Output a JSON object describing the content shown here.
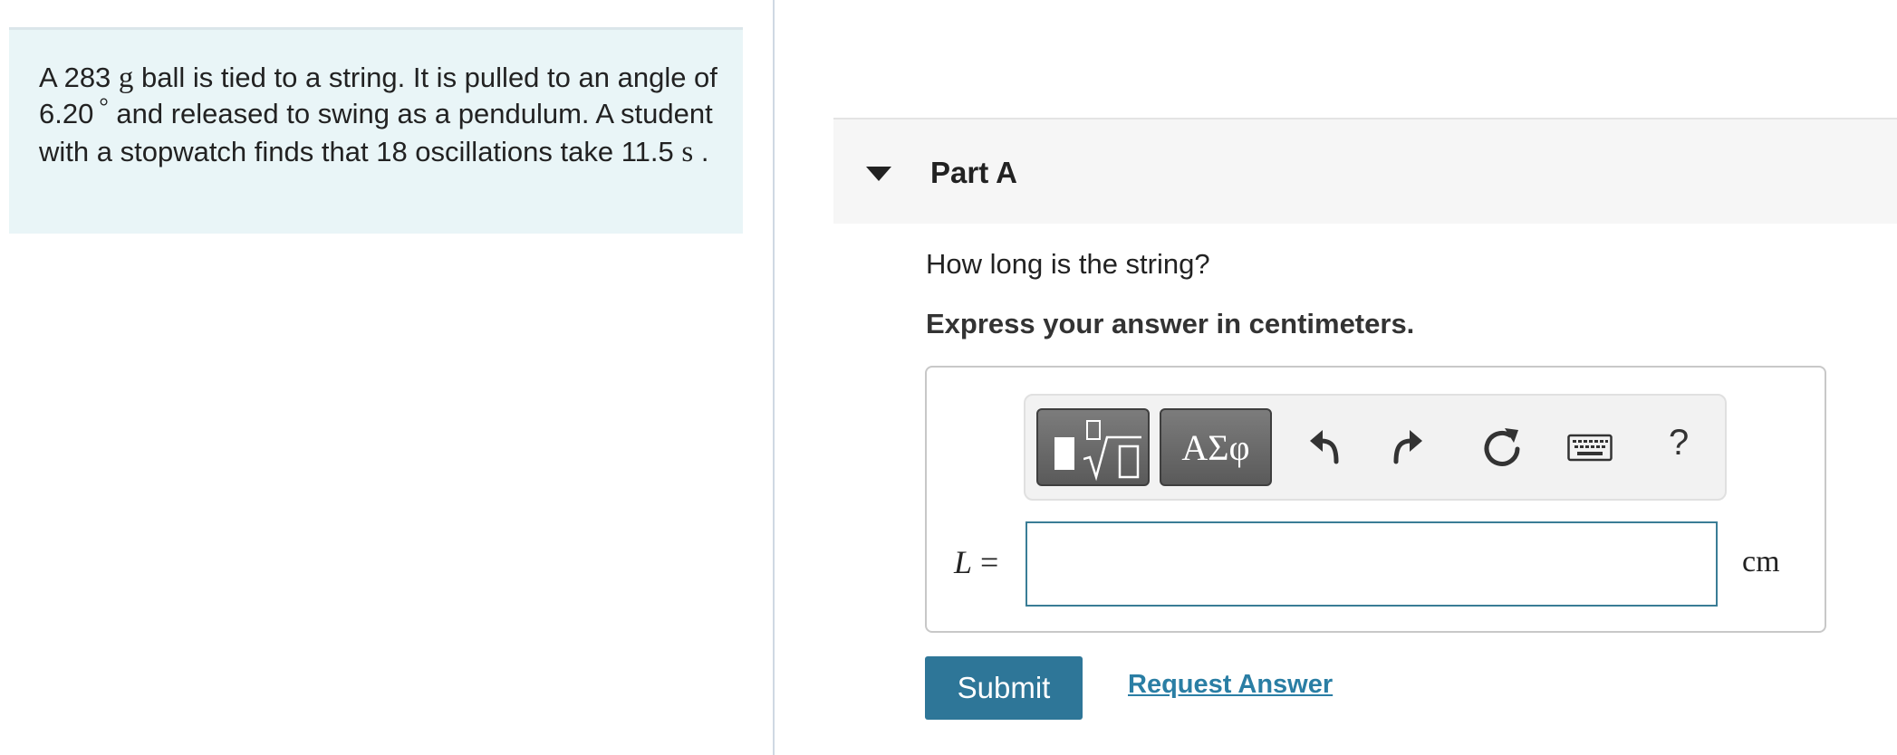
{
  "problem": {
    "segments": [
      "A 283 ",
      "g",
      " ball is tied to a string. It is pulled to an angle of 6.20",
      "°",
      " and released to swing as a pendulum. A student with a stopwatch finds that 18 oscillations take 11.5 ",
      "s",
      " ."
    ]
  },
  "part": {
    "title": "Part A",
    "question": "How long is the string?",
    "instruction": "Express your answer in centimeters."
  },
  "toolbar": {
    "greek_label": "ΑΣφ",
    "help_label": "?"
  },
  "answer": {
    "variable": "L",
    "equals": "=",
    "value": "",
    "unit": "cm"
  },
  "actions": {
    "submit_label": "Submit",
    "request_answer_label": "Request Answer"
  },
  "colors": {
    "problem_background": "#e9f5f7",
    "submit_background": "#2e7698",
    "link_color": "#2a7ea4",
    "input_border": "#3a7d96"
  }
}
